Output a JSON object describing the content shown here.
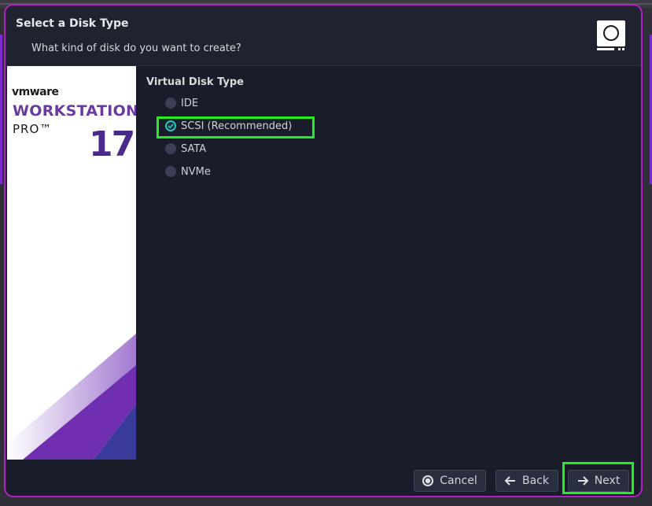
{
  "dialog": {
    "title": "Select a Disk Type",
    "subtitle": "What kind of disk do you want to create?",
    "icon": "disk-icon"
  },
  "banner": {
    "brand": "vmware",
    "product": "WORKSTATION",
    "edition": "PRO™",
    "version": "17"
  },
  "disk_type": {
    "label": "Virtual Disk Type",
    "options": [
      {
        "label": "IDE",
        "selected": false
      },
      {
        "label": "SCSI (Recommended)",
        "selected": true
      },
      {
        "label": "SATA",
        "selected": false
      },
      {
        "label": "NVMe",
        "selected": false
      }
    ]
  },
  "buttons": {
    "cancel": "Cancel",
    "back": "Back",
    "next": "Next"
  },
  "colors": {
    "accent": "#b31fc4",
    "highlight": "#22ee22",
    "radio_checked": "#23c6b8"
  }
}
